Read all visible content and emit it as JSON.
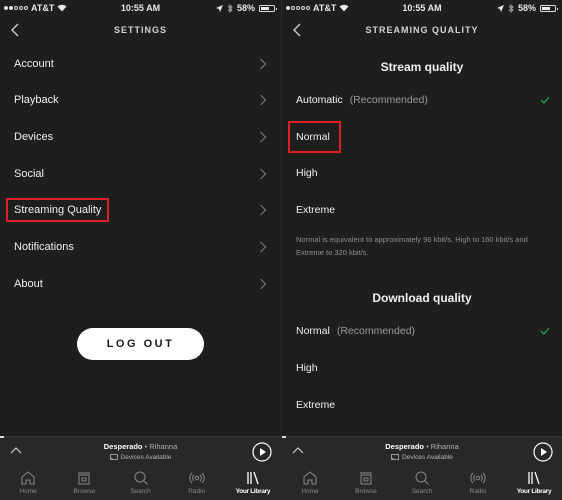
{
  "status_bar": {
    "carrier": "AT&T",
    "time": "10:55 AM",
    "battery": "58%",
    "battery_level": 0.58,
    "left_signal_bars": 2,
    "right_signal_bars": 1
  },
  "settings_screen": {
    "title": "SETTINGS",
    "items": [
      {
        "label": "Account"
      },
      {
        "label": "Playback"
      },
      {
        "label": "Devices"
      },
      {
        "label": "Social"
      },
      {
        "label": "Streaming Quality",
        "highlighted": true
      },
      {
        "label": "Notifications"
      },
      {
        "label": "About"
      }
    ],
    "logout_label": "LOG OUT"
  },
  "streaming_screen": {
    "title": "STREAMING QUALITY",
    "stream_section_title": "Stream quality",
    "stream_options": [
      {
        "label": "Automatic",
        "note": "(Recommended)",
        "selected": true
      },
      {
        "label": "Normal",
        "highlighted": true
      },
      {
        "label": "High"
      },
      {
        "label": "Extreme"
      }
    ],
    "description": "Normal is equivalent to approximately 96 kbit/s, High to 160 kbit/s and Extreme to 320 kbit/s.",
    "download_section_title": "Download quality",
    "download_options": [
      {
        "label": "Normal",
        "note": "(Recommended)",
        "selected": true
      },
      {
        "label": "High"
      },
      {
        "label": "Extreme"
      }
    ]
  },
  "mini_player": {
    "track": "Desperado",
    "separator": " • ",
    "artist": "Rihanna",
    "devices": "Devices Available"
  },
  "tab_bar": {
    "tabs": [
      {
        "label": "Home",
        "icon": "home-icon"
      },
      {
        "label": "Browse",
        "icon": "browse-icon"
      },
      {
        "label": "Search",
        "icon": "search-icon"
      },
      {
        "label": "Radio",
        "icon": "radio-icon"
      },
      {
        "label": "Your Library",
        "icon": "library-icon",
        "active": true
      }
    ]
  },
  "colors": {
    "background": "#1e1e1e",
    "highlight_box": "#e01e26",
    "check_green": "#1db954",
    "bar": "#282828"
  }
}
